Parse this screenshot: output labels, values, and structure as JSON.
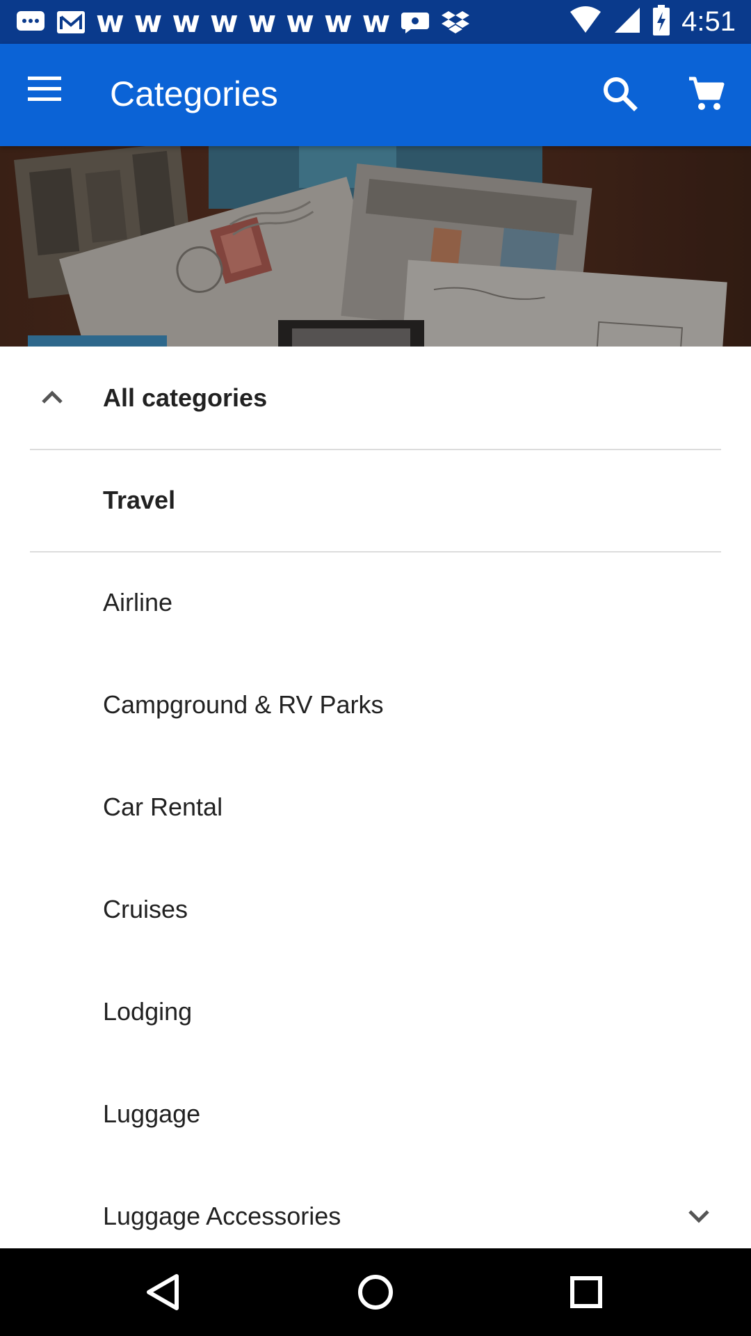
{
  "status_bar": {
    "time": "4:51",
    "notification_icons": [
      "messages-icon",
      "gmail-icon",
      "w-app-icon",
      "w-app-icon",
      "w-app-icon",
      "w-app-icon",
      "w-app-icon",
      "w-app-icon",
      "w-app-icon",
      "w-app-icon",
      "chat-bubble-icon",
      "dropbox-icon"
    ],
    "w_glyph": "w"
  },
  "app_bar": {
    "title": "Categories",
    "background": "#0b63d6"
  },
  "list": {
    "header": "All categories",
    "parent": "Travel",
    "items": [
      "Airline",
      "Campground & RV Parks",
      "Car Rental",
      "Cruises",
      "Lodging",
      "Luggage",
      "Luggage Accessories"
    ]
  },
  "colors": {
    "status_bar": "#0a3a8c",
    "app_bar": "#0b63d6",
    "text": "#212121",
    "divider": "#dcdcdc"
  }
}
